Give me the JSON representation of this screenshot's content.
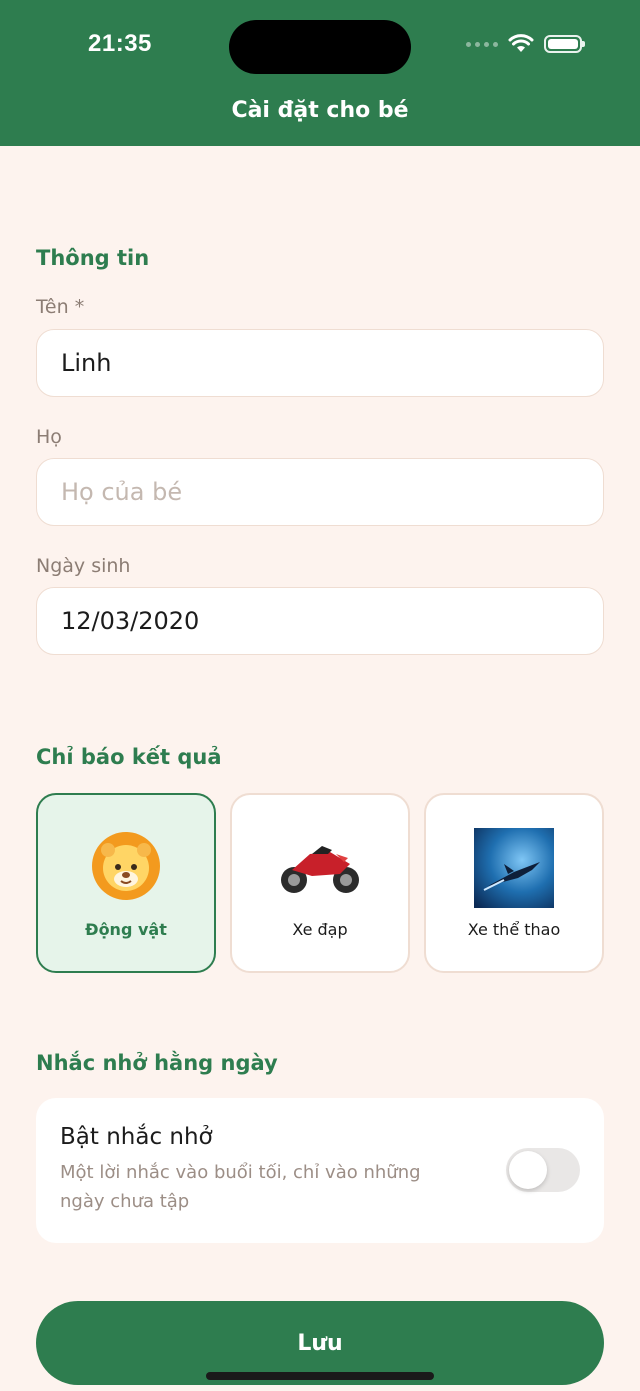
{
  "status_bar": {
    "time": "21:35"
  },
  "header": {
    "title": "Cài đặt cho bé"
  },
  "info_section": {
    "title": "Thông tin",
    "first_name": {
      "label": "Tên *",
      "value": "Linh"
    },
    "last_name": {
      "label": "Họ",
      "placeholder": "Họ của bé"
    },
    "birthday": {
      "label": "Ngày sinh",
      "value": "12/03/2020"
    }
  },
  "indicator_section": {
    "title": "Chỉ báo kết quả",
    "options": [
      {
        "label": "Động vật",
        "icon": "lion-icon",
        "selected": true
      },
      {
        "label": "Xe đạp",
        "icon": "motorcycle-icon",
        "selected": false
      },
      {
        "label": "Xe thể thao",
        "icon": "jet-icon",
        "selected": false
      }
    ]
  },
  "reminder_section": {
    "title": "Nhắc nhở hằng ngày",
    "toggle_title": "Bật nhắc nhở",
    "toggle_description": "Một lời nhắc vào buổi tối, chỉ vào những ngày chưa tập",
    "enabled": false
  },
  "save_button": {
    "label": "Lưu"
  },
  "colors": {
    "primary": "#2e7d4f",
    "background": "#fdf3ee",
    "selected_bg": "#e6f4ea"
  }
}
